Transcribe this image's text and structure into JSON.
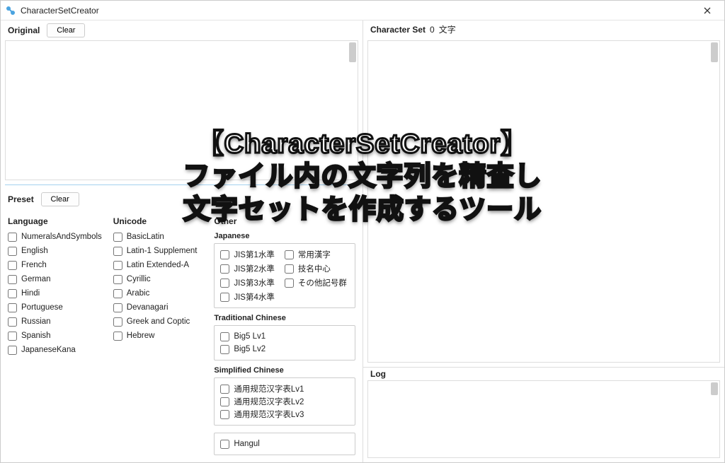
{
  "titlebar": {
    "title": "CharacterSetCreator"
  },
  "original": {
    "label": "Original",
    "clear": "Clear"
  },
  "preset": {
    "label": "Preset",
    "clear": "Clear"
  },
  "columns": {
    "language": {
      "header": "Language",
      "items": [
        "NumeralsAndSymbols",
        "English",
        "French",
        "German",
        "Hindi",
        "Portuguese",
        "Russian",
        "Spanish",
        "JapaneseKana"
      ]
    },
    "unicode": {
      "header": "Unicode",
      "items": [
        "BasicLatin",
        "Latin-1 Supplement",
        "Latin Extended-A",
        "Cyrillic",
        "Arabic",
        "Devanagari",
        "Greek and Coptic",
        "Hebrew"
      ]
    },
    "other": {
      "header": "Other",
      "japanese": {
        "header": "Japanese",
        "left": [
          "JIS第1水準",
          "JIS第2水準",
          "JIS第3水準",
          "JIS第4水準"
        ],
        "right": [
          "常用漢字",
          "技名中心",
          "その他記号群"
        ]
      },
      "trad": {
        "header": "Traditional Chinese",
        "items": [
          "Big5 Lv1",
          "Big5 Lv2"
        ]
      },
      "simp": {
        "header": "Simplified Chinese",
        "items": [
          "通用规范汉字表Lv1",
          "通用规范汉字表Lv2",
          "通用规范汉字表Lv3"
        ]
      },
      "hangul": "Hangul"
    }
  },
  "charset": {
    "label": "Character Set",
    "count": "0",
    "unit": "文字"
  },
  "log": {
    "label": "Log"
  },
  "overlay": {
    "line1": "【CharacterSetCreator】",
    "line2": "ファイル内の文字列を精査し",
    "line3": "文字セットを作成するツール"
  }
}
